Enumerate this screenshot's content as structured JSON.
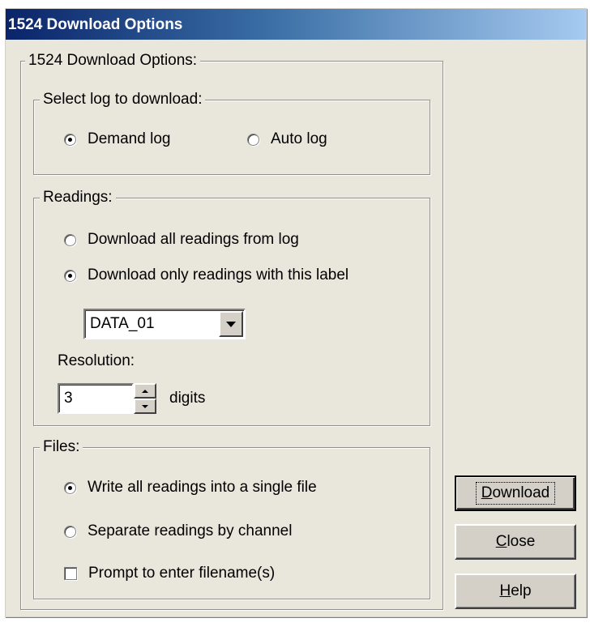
{
  "window": {
    "title": "1524 Download Options"
  },
  "main_group": {
    "label": "1524 Download Options:"
  },
  "log_group": {
    "label": "Select log to download:",
    "options": [
      {
        "label": "Demand log",
        "selected": true
      },
      {
        "label": "Auto log",
        "selected": false
      }
    ]
  },
  "readings_group": {
    "label": "Readings:",
    "options": [
      {
        "label": "Download all readings from log",
        "selected": false
      },
      {
        "label": "Download only readings with this label",
        "selected": true
      }
    ],
    "label_select": {
      "value": "DATA_01"
    },
    "resolution": {
      "label": "Resolution:",
      "value": "3",
      "unit": "digits"
    }
  },
  "files_group": {
    "label": "Files:",
    "options": [
      {
        "label": "Write all readings into a single file",
        "selected": true
      },
      {
        "label": "Separate readings by channel",
        "selected": false
      }
    ],
    "prompt_checkbox": {
      "label": "Prompt to enter filename(s)",
      "checked": false
    }
  },
  "buttons": {
    "download": {
      "label": "Download",
      "mnemonic": "D",
      "rest": "ownload"
    },
    "close": {
      "label": "Close",
      "mnemonic": "C",
      "rest": "lose"
    },
    "help": {
      "label": "Help",
      "mnemonic": "H",
      "rest": "elp"
    }
  }
}
